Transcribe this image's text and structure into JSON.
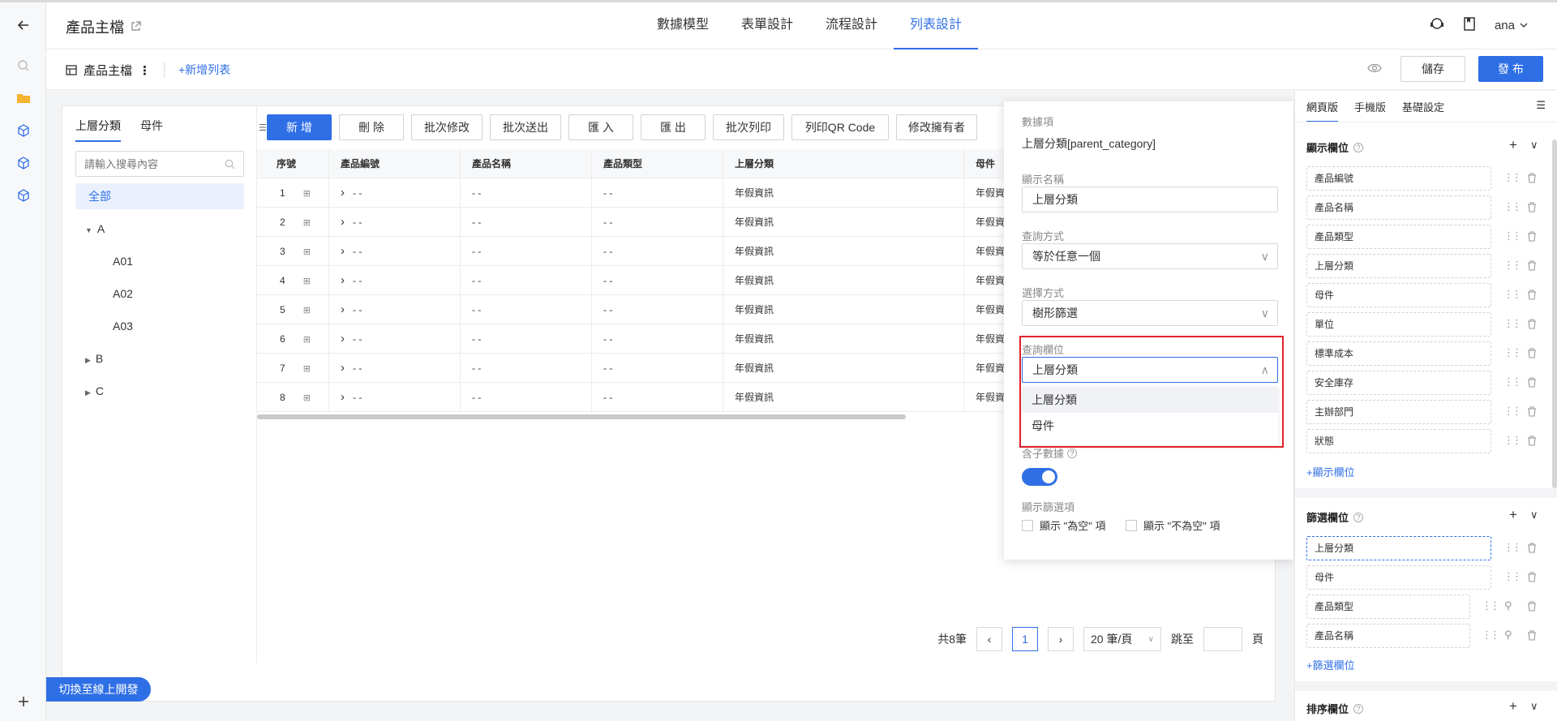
{
  "header": {
    "app_title": "產品主檔",
    "tabs": [
      "數據模型",
      "表單設計",
      "流程設計",
      "列表設計"
    ],
    "active_tab": "列表設計",
    "user": "ana"
  },
  "subheader": {
    "list_tab": "產品主檔",
    "add_list": "+新增列表",
    "save_label": "儲存",
    "publish_label": "發 布"
  },
  "tree": {
    "tabs": [
      "上層分類",
      "母件"
    ],
    "search_placeholder": "請輸入搜尋內容",
    "all_label": "全部",
    "nodes": [
      "A",
      "A01",
      "A02",
      "A03",
      "B",
      "C"
    ]
  },
  "toolbar": [
    "新 增",
    "刪 除",
    "批次修改",
    "批次送出",
    "匯 入",
    "匯 出",
    "批次列印",
    "列印QR Code",
    "修改擁有者"
  ],
  "table": {
    "columns": [
      "序號",
      "產品編號",
      "產品名稱",
      "產品類型",
      "上層分類",
      "母件"
    ],
    "rows": [
      {
        "no": "1",
        "code": "- -",
        "name": "- -",
        "type": "- -",
        "parent": "年假資訊",
        "mother": "年假資"
      },
      {
        "no": "2",
        "code": "- -",
        "name": "- -",
        "type": "- -",
        "parent": "年假資訊",
        "mother": "年假資"
      },
      {
        "no": "3",
        "code": "- -",
        "name": "- -",
        "type": "- -",
        "parent": "年假資訊",
        "mother": "年假資"
      },
      {
        "no": "4",
        "code": "- -",
        "name": "- -",
        "type": "- -",
        "parent": "年假資訊",
        "mother": "年假資"
      },
      {
        "no": "5",
        "code": "- -",
        "name": "- -",
        "type": "- -",
        "parent": "年假資訊",
        "mother": "年假資"
      },
      {
        "no": "6",
        "code": "- -",
        "name": "- -",
        "type": "- -",
        "parent": "年假資訊",
        "mother": "年假資"
      },
      {
        "no": "7",
        "code": "- -",
        "name": "- -",
        "type": "- -",
        "parent": "年假資訊",
        "mother": "年假資"
      },
      {
        "no": "8",
        "code": "- -",
        "name": "- -",
        "type": "- -",
        "parent": "年假資訊",
        "mother": "年假資"
      }
    ]
  },
  "pager": {
    "total": "共8筆",
    "current_page": "1",
    "page_size": "20 筆/頁",
    "goto_label": "跳至",
    "page_unit": "頁"
  },
  "switch_label": "切換至線上開發",
  "popup": {
    "data_item_label": "數據項",
    "data_item_value": "上層分類[parent_category]",
    "display_name_label": "顯示名稱",
    "display_name_value": "上層分類",
    "query_mode_label": "查詢方式",
    "query_mode_value": "等於任意一個",
    "select_mode_label": "選擇方式",
    "select_mode_value": "樹形篩選",
    "query_field_label": "查詢欄位",
    "query_field_value": "上層分類",
    "dropdown_options": [
      "上層分類",
      "母件"
    ],
    "child_data_label": "含子數據",
    "show_filter_label": "顯示篩選項",
    "show_empty_label": "顯示 \"為空\" 項",
    "show_not_empty_label": "顯示 \"不為空\" 項"
  },
  "rpanel": {
    "tabs": [
      "網頁版",
      "手機版",
      "基礎設定"
    ],
    "display_section": "顯示欄位",
    "display_fields": [
      "產品編號",
      "產品名稱",
      "產品類型",
      "上層分類",
      "母件",
      "單位",
      "標準成本",
      "安全庫存",
      "主辦部門",
      "狀態"
    ],
    "add_display": "+顯示欄位",
    "filter_section": "篩選欄位",
    "filter_fields": [
      "上層分類",
      "母件",
      "產品類型",
      "產品名稱"
    ],
    "add_filter": "+篩選欄位",
    "sort_section": "排序欄位"
  }
}
